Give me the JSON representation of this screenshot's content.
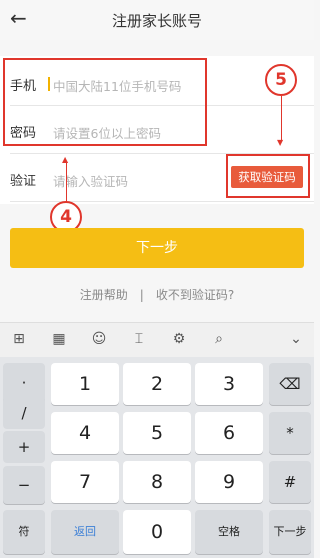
{
  "header": {
    "title": "注册家长账号",
    "back_icon": "arrow-left-icon"
  },
  "form": {
    "phone": {
      "label": "手机",
      "placeholder": "中国大陆11位手机号码"
    },
    "password": {
      "label": "密码",
      "placeholder": "请设置6位以上密码"
    },
    "code": {
      "label": "验证",
      "placeholder": "请输入验证码",
      "button": "获取验证码"
    }
  },
  "annotations": {
    "badge_4": "4",
    "badge_5": "5",
    "color": "#e0362c"
  },
  "actions": {
    "next": "下一步",
    "help": "注册帮助",
    "separator": "|",
    "no_code": "收不到验证码?"
  },
  "keyboard": {
    "toolbar": [
      "apps-grid-icon",
      "keyboard-icon",
      "emoji-icon",
      "cursor-icon",
      "settings-icon",
      "search-icon",
      "chevron-down-icon"
    ],
    "left_keys": [
      "·",
      "/",
      "+",
      "−"
    ],
    "digits": [
      "1",
      "2",
      "3",
      "4",
      "5",
      "6",
      "7",
      "8",
      "9"
    ],
    "right_keys": [
      "⌫",
      "*",
      "#"
    ],
    "bottom": {
      "symbol": "符",
      "back": "返回",
      "zero": "0",
      "space": "空格",
      "next": "下一步"
    }
  },
  "colors": {
    "accent_yellow": "#f5be14",
    "code_button": "#e85b3b"
  }
}
